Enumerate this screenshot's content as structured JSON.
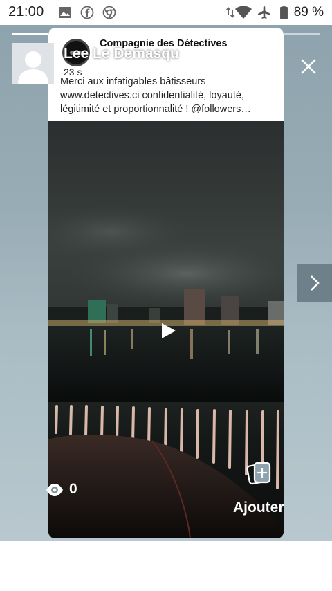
{
  "status_bar": {
    "time": "21:00",
    "battery": "89 %",
    "icons": [
      "image-icon",
      "facebook-icon",
      "chrome-icon",
      "data-arrows-icon",
      "wifi-icon",
      "airplane-icon",
      "battery-icon"
    ]
  },
  "story": {
    "user_name": "Lee Le Demasqu",
    "time_ago": "23 s",
    "views": "0",
    "add_label": "Ajouter",
    "post": {
      "page_name": "Compagnie des Détectives",
      "line1": "Merci aux infatigables bâtisseurs",
      "line2": "www.detectives.ci confidentialité, loyauté,",
      "line3": "légitimité et proportionnalité ! @followers…"
    }
  },
  "colors": {
    "background": "#98acb5",
    "next_button": "#6e8089",
    "text_white": "#ffffff"
  }
}
